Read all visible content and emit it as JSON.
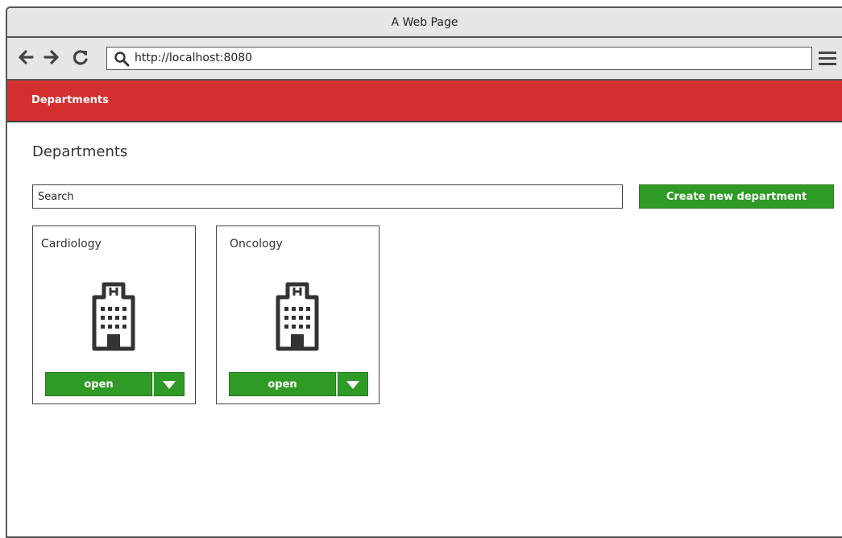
{
  "window": {
    "title": "A Web Page"
  },
  "browser": {
    "url": "http://localhost:8080",
    "icons": [
      "back-arrow-icon",
      "forward-arrow-icon",
      "reload-icon",
      "search-icon",
      "hamburger-menu-icon"
    ]
  },
  "navbar": {
    "brand": "Departments",
    "color": "#d32f2f"
  },
  "main": {
    "title": "Departments",
    "search": {
      "placeholder": "Search",
      "value": ""
    },
    "create_button": "Create new department",
    "accent": "#2f9a26"
  },
  "departments": [
    {
      "name": "Cardiology",
      "icon": "hospital-building-icon",
      "open_label": "open"
    },
    {
      "name": "Oncology",
      "icon": "hospital-building-icon",
      "open_label": "open"
    }
  ]
}
